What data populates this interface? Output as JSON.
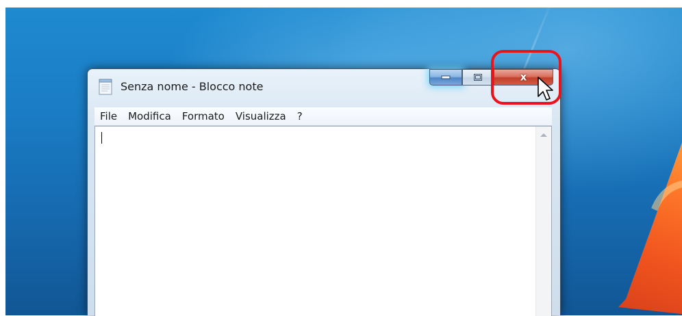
{
  "window": {
    "title": "Senza nome - Blocco note",
    "app_icon": "notepad-icon"
  },
  "caption_buttons": {
    "minimize_icon": "minimize-icon",
    "maximize_icon": "maximize-icon",
    "close_glyph": "x",
    "close_icon": "close-icon"
  },
  "menubar": {
    "items": [
      {
        "label": "File"
      },
      {
        "label": "Modifica"
      },
      {
        "label": "Formato"
      },
      {
        "label": "Visualizza"
      },
      {
        "label": "?"
      }
    ]
  },
  "editor": {
    "text": ""
  },
  "annotation": {
    "highlight_color": "#e8141c",
    "target": "close-button"
  },
  "colors": {
    "close_red": "#c1402b",
    "minimize_blue": "#4f86c6",
    "desktop_blue": "#1a7cc4",
    "logo_orange": "#f0541e"
  }
}
